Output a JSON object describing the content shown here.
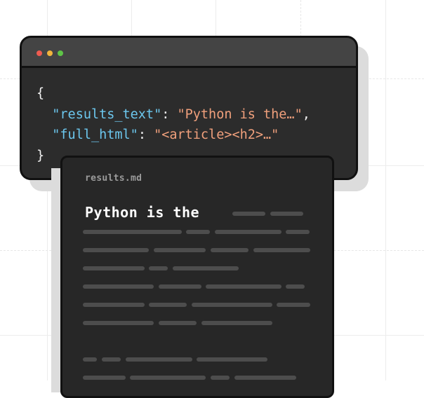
{
  "code_window": {
    "lines": {
      "open_brace": "{",
      "line1": {
        "key": "\"results_text\"",
        "sep": ": ",
        "value": "\"Python is the…\"",
        "end": ","
      },
      "line2": {
        "key": "\"full_html\"",
        "sep": ": ",
        "value": "\"<article><h2>…\""
      },
      "close_brace": "}"
    }
  },
  "markdown_card": {
    "filename": "results.md",
    "heading": "Python is the"
  },
  "colors": {
    "json_key": "#6cc7ee",
    "json_string": "#f0a07c",
    "window_bg": "#2c2c2c",
    "card_bg": "#272727"
  }
}
